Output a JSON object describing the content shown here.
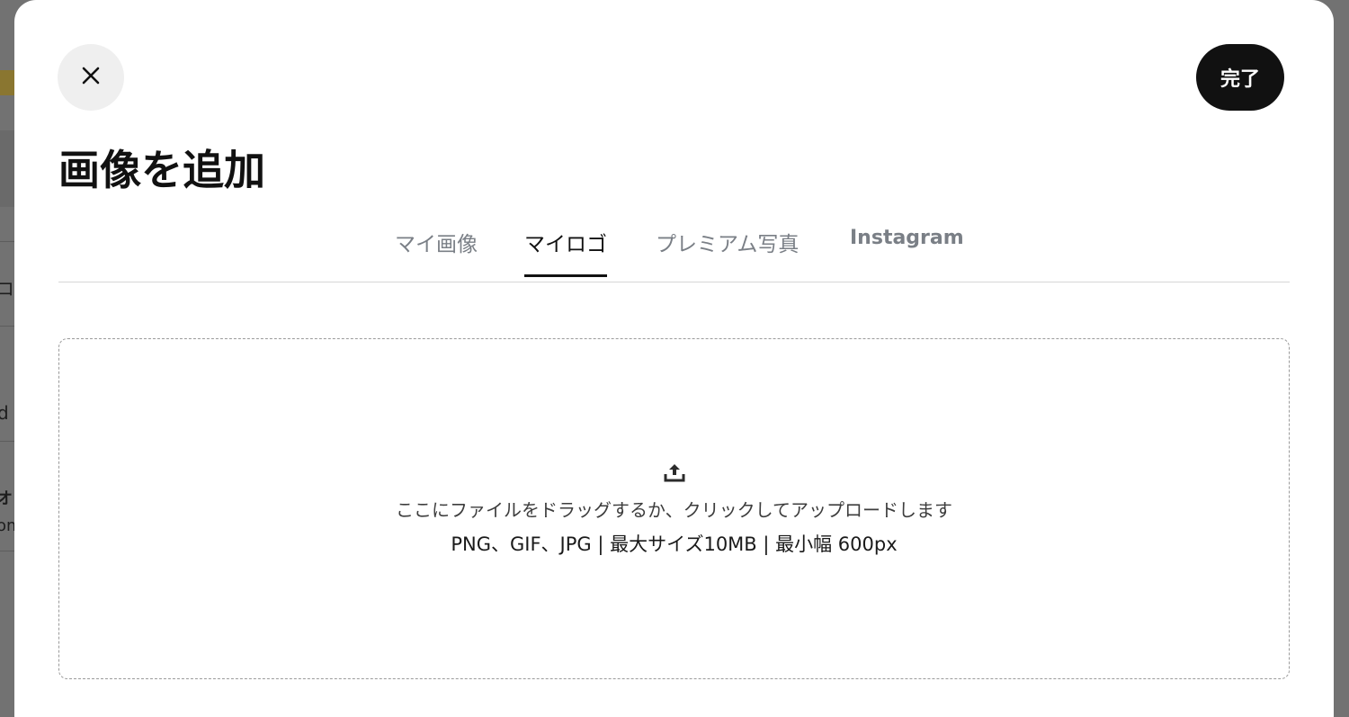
{
  "background": {
    "fragments": [
      "d",
      "オ",
      "om",
      "コ"
    ]
  },
  "modal": {
    "close_icon": "close-icon",
    "done_label": "完了",
    "title": "画像を追加",
    "tabs": [
      {
        "label": "マイ画像",
        "active": false
      },
      {
        "label": "マイロゴ",
        "active": true
      },
      {
        "label": "プレミアム写真",
        "active": false
      },
      {
        "label": "Instagram",
        "active": false
      }
    ],
    "dropzone": {
      "icon": "upload-icon",
      "instruction": "ここにファイルをドラッグするか、クリックしてアップロードします",
      "requirements": "PNG、GIF、JPG | 最大サイズ10MB | 最小幅 600px"
    }
  },
  "colors": {
    "accent": "#111111",
    "muted_tab": "#7a7f86",
    "close_bg": "#efefef"
  }
}
